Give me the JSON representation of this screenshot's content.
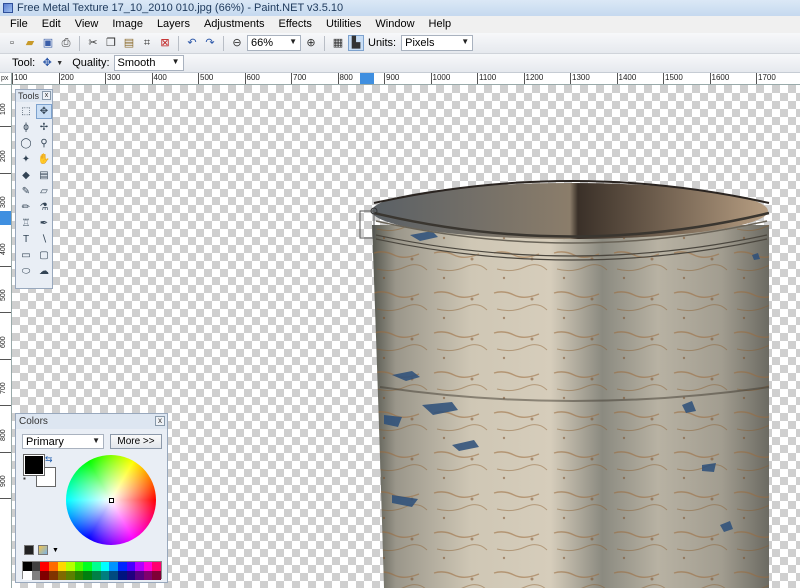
{
  "window": {
    "title": "Free Metal Texture 17_10_2010 010.jpg (66%) - Paint.NET v3.5.10"
  },
  "menu": [
    "File",
    "Edit",
    "View",
    "Image",
    "Layers",
    "Adjustments",
    "Effects",
    "Utilities",
    "Window",
    "Help"
  ],
  "toolbar": {
    "zoom_value": "66%",
    "units_label": "Units:",
    "units_value": "Pixels"
  },
  "tool_options": {
    "tool_label": "Tool:",
    "quality_label": "Quality:",
    "quality_value": "Smooth"
  },
  "ruler": {
    "unit": "px",
    "h_labels": [
      "100",
      "200",
      "300",
      "400",
      "500",
      "600",
      "700",
      "800",
      "900",
      "1000",
      "1100",
      "1200",
      "1300",
      "1400",
      "1500",
      "1600",
      "1700"
    ],
    "v_labels": [
      "100",
      "200",
      "300",
      "400",
      "500",
      "600",
      "700",
      "800",
      "900"
    ]
  },
  "tools_panel": {
    "title": "Tools",
    "close_label": "x",
    "tools": [
      {
        "name": "rectangle-select-icon",
        "glyph": "⬚"
      },
      {
        "name": "move-selection-icon",
        "glyph": "✥"
      },
      {
        "name": "lasso-select-icon",
        "glyph": "ϕ"
      },
      {
        "name": "move-selected-icon",
        "glyph": "✢"
      },
      {
        "name": "ellipse-select-icon",
        "glyph": "◯"
      },
      {
        "name": "zoom-icon",
        "glyph": "⚲"
      },
      {
        "name": "magic-wand-icon",
        "glyph": "✦"
      },
      {
        "name": "pan-icon",
        "glyph": "✋"
      },
      {
        "name": "paint-bucket-icon",
        "glyph": "◆"
      },
      {
        "name": "gradient-icon",
        "glyph": "▤"
      },
      {
        "name": "paintbrush-icon",
        "glyph": "✎"
      },
      {
        "name": "eraser-icon",
        "glyph": "▱"
      },
      {
        "name": "pencil-icon",
        "glyph": "✏"
      },
      {
        "name": "color-picker-icon",
        "glyph": "⚗"
      },
      {
        "name": "clone-stamp-icon",
        "glyph": "♖"
      },
      {
        "name": "recolor-icon",
        "glyph": "✒"
      },
      {
        "name": "text-icon",
        "glyph": "T"
      },
      {
        "name": "line-curve-icon",
        "glyph": "∖"
      },
      {
        "name": "rectangle-icon",
        "glyph": "▭"
      },
      {
        "name": "rounded-rectangle-icon",
        "glyph": "▢"
      },
      {
        "name": "ellipse-icon",
        "glyph": "⬭"
      },
      {
        "name": "freeform-shape-icon",
        "glyph": "☁"
      }
    ]
  },
  "colors_panel": {
    "title": "Colors",
    "close_label": "x",
    "mode_value": "Primary",
    "more_label": "More >>",
    "primary_color": "#000000",
    "secondary_color": "#ffffff",
    "palette": [
      "#000000",
      "#404040",
      "#ff0000",
      "#ff6a00",
      "#ffd800",
      "#b6ff00",
      "#4cff00",
      "#00ff21",
      "#00ff90",
      "#00ffff",
      "#0094ff",
      "#0026ff",
      "#4800ff",
      "#b200ff",
      "#ff00dc",
      "#ff006e",
      "#ffffff",
      "#808080",
      "#7f0000",
      "#7f3300",
      "#7f6a00",
      "#5b7f00",
      "#267f00",
      "#007f0e",
      "#007f46",
      "#007f7f",
      "#004a7f",
      "#00137f",
      "#21007f",
      "#57007f",
      "#7f006e",
      "#7f0037"
    ]
  }
}
